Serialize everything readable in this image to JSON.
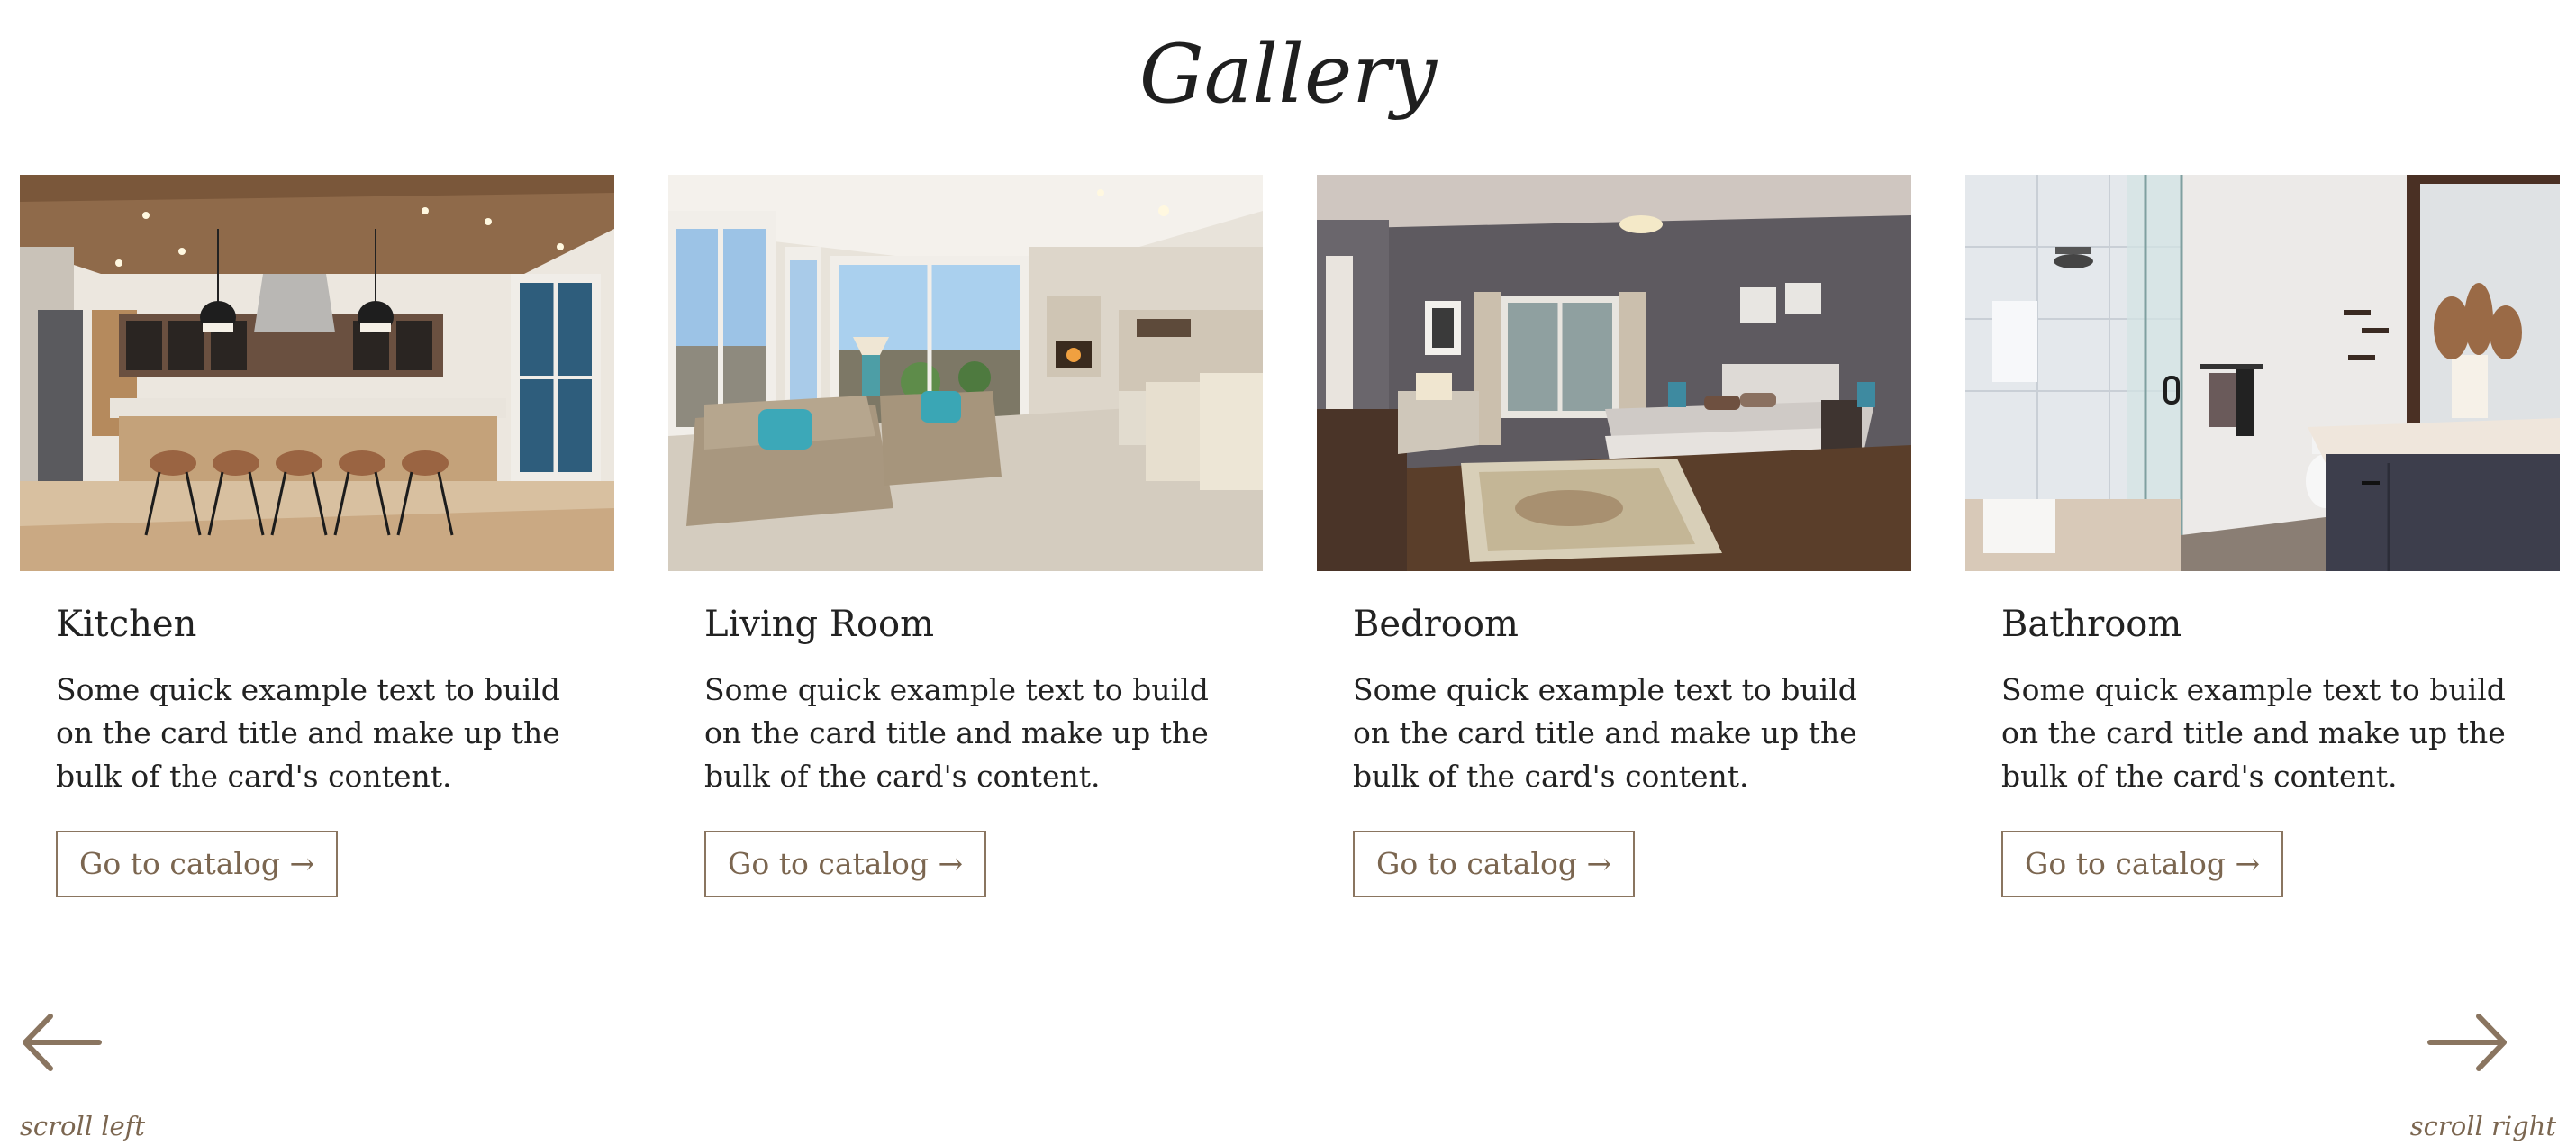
{
  "page": {
    "title": "Gallery"
  },
  "cards": [
    {
      "title": "Kitchen",
      "text": "Some quick example text to build on the card title and make up the bulk of the card's content.",
      "button_label": "Go to catalog →",
      "image_name": "kitchen-photo"
    },
    {
      "title": "Living Room",
      "text": "Some quick example text to build on the card title and make up the bulk of the card's content.",
      "button_label": "Go to catalog →",
      "image_name": "living-room-photo"
    },
    {
      "title": "Bedroom",
      "text": "Some quick example text to build on the card title and make up the bulk of the card's content.",
      "button_label": "Go to catalog →",
      "image_name": "bedroom-photo"
    },
    {
      "title": "Bathroom",
      "text": "Some quick example text to build on the card title and make up the bulk of the card's content.",
      "button_label": "Go to catalog →",
      "image_name": "bathroom-photo"
    }
  ],
  "nav": {
    "left_label": "scroll left",
    "right_label": "scroll right",
    "left_icon": "arrow-left-icon",
    "right_icon": "arrow-right-icon"
  },
  "colors": {
    "accent": "#8a7560",
    "text": "#1f1f1f",
    "background": "#ffffff"
  }
}
